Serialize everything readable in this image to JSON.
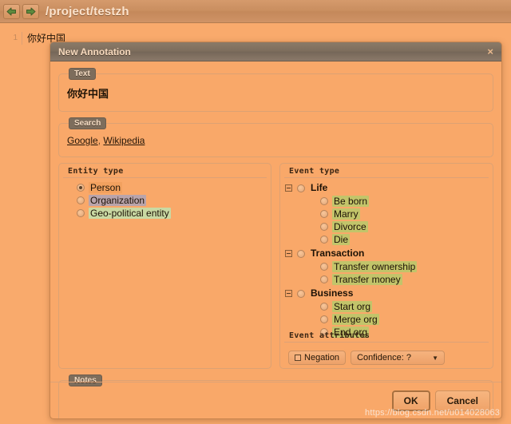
{
  "topbar": {
    "back_icon": "arrow-left-icon",
    "forward_icon": "arrow-right-icon",
    "path": "/project/testzh"
  },
  "document": {
    "line_number": "1",
    "line_text": "你好中国"
  },
  "dialog": {
    "title": "New Annotation",
    "close_label": "×",
    "text_section": {
      "legend": "Text",
      "value": "你好中国"
    },
    "search_section": {
      "legend": "Search",
      "links": [
        "Google",
        "Wikipedia"
      ],
      "separator": ","
    },
    "entity_type": {
      "heading": "Entity type",
      "options": [
        {
          "label": "Person",
          "checked": true,
          "highlight": "#f2a15f"
        },
        {
          "label": "Organization",
          "checked": false,
          "highlight": "#b9a4ab"
        },
        {
          "label": "Geo-political entity",
          "checked": false,
          "highlight": "#c9d9a3"
        }
      ]
    },
    "event_type": {
      "heading": "Event type",
      "groups": [
        {
          "label": "Life",
          "checked": false,
          "toggle_icon": "collapse-minus-icon",
          "children": [
            {
              "label": "Be born",
              "checked": false,
              "highlight": "#c2c46a"
            },
            {
              "label": "Marry",
              "checked": false,
              "highlight": "#c2c46a"
            },
            {
              "label": "Divorce",
              "checked": false,
              "highlight": "#c2c46a"
            },
            {
              "label": "Die",
              "checked": false,
              "highlight": "#c2c46a"
            }
          ]
        },
        {
          "label": "Transaction",
          "checked": false,
          "toggle_icon": "collapse-minus-icon",
          "children": [
            {
              "label": "Transfer ownership",
              "checked": false,
              "highlight": "#c2c46a"
            },
            {
              "label": "Transfer money",
              "checked": false,
              "highlight": "#c2c46a"
            }
          ]
        },
        {
          "label": "Business",
          "checked": false,
          "toggle_icon": "collapse-minus-icon",
          "children": [
            {
              "label": "Start org",
              "checked": false,
              "highlight": "#c2c46a"
            },
            {
              "label": "Merge org",
              "checked": false,
              "highlight": "#c2c46a"
            },
            {
              "label": "End org",
              "checked": false,
              "highlight": "#c2c46a"
            }
          ]
        }
      ]
    },
    "event_attributes": {
      "heading": "Event attributes",
      "negation_label": "Negation",
      "negation_checked": false,
      "confidence_label": "Confidence: ?",
      "caret_icon": "chevron-down-icon"
    },
    "notes_section": {
      "legend": "Notes",
      "value": "",
      "clear_label": "×",
      "clear_icon": "clear-x-icon"
    },
    "footer": {
      "ok_label": "OK",
      "cancel_label": "Cancel"
    }
  },
  "watermark": {
    "text": "https://blog.csdn.net/u014028063"
  },
  "colors": {
    "page_background": "#f9aa6c",
    "titlebar": "#7d6d5c",
    "legend_badge": "#7d6d5c",
    "border": "#dca273"
  }
}
